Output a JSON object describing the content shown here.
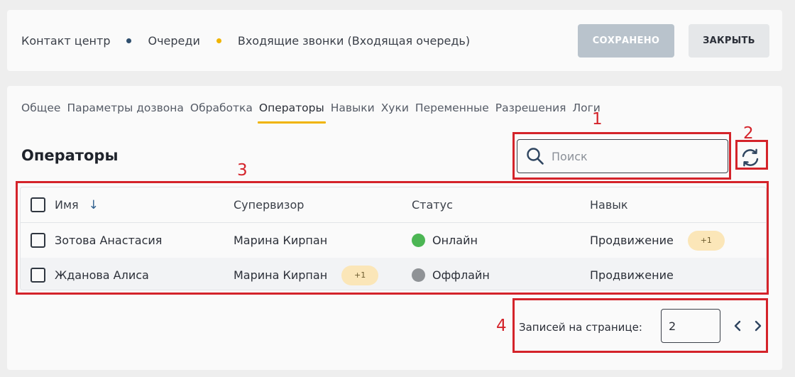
{
  "breadcrumbs": [
    {
      "label": "Контакт центр",
      "dot_color": "#2f4f6e"
    },
    {
      "label": "Очереди",
      "dot_color": "#f0b400"
    },
    {
      "label": "Входящие звонки (Входящая очередь)"
    }
  ],
  "header": {
    "saved_label": "СОХРАНЕНО",
    "close_label": "ЗАКРЫТЬ"
  },
  "tabs": [
    {
      "label": "Общее"
    },
    {
      "label": "Параметры дозвона"
    },
    {
      "label": "Обработка"
    },
    {
      "label": "Операторы",
      "active": true
    },
    {
      "label": "Навыки"
    },
    {
      "label": "Хуки"
    },
    {
      "label": "Переменные"
    },
    {
      "label": "Разрешения"
    },
    {
      "label": "Логи"
    }
  ],
  "section": {
    "title": "Операторы"
  },
  "search": {
    "placeholder": "Поиск",
    "value": "",
    "icon": "search-icon"
  },
  "refresh": {
    "icon": "refresh-icon"
  },
  "table": {
    "columns": {
      "name": "Имя",
      "supervisor": "Супервизор",
      "status": "Статус",
      "skill": "Навык"
    },
    "sort_icon": "↓",
    "rows": [
      {
        "name": "Зотова Анастасия",
        "supervisor": "Марина Кирпан",
        "supervisor_extra": "",
        "status": "Онлайн",
        "status_color": "#4cb654",
        "skill": "Продвижение",
        "skill_extra": "+1"
      },
      {
        "name": "Жданова Алиса",
        "supervisor": "Марина Кирпан",
        "supervisor_extra": "+1",
        "status": "Оффлайн",
        "status_color": "#8f9296",
        "skill": "Продвижение",
        "skill_extra": ""
      }
    ]
  },
  "pagination": {
    "label": "Записей на странице:",
    "per_page": "2"
  },
  "annotations": {
    "n1": "1",
    "n2": "2",
    "n3": "3",
    "n4": "4",
    "color": "#d4232a"
  },
  "colors": {
    "accent": "#f0b400",
    "saved_button": "#b9c3cc",
    "close_button": "#e5e7e9"
  }
}
